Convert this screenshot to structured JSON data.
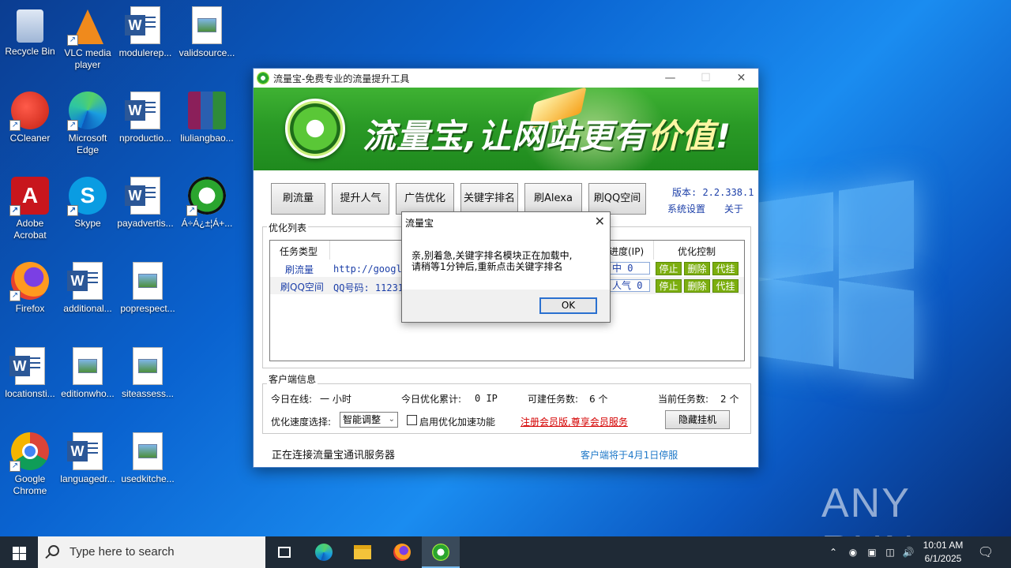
{
  "desktop": {
    "icons": [
      {
        "label": "Recycle Bin",
        "icon": "recycle-bin-icon"
      },
      {
        "label": "VLC media player",
        "icon": "vlc-icon"
      },
      {
        "label": "modulerep...",
        "icon": "word-doc-icon"
      },
      {
        "label": "validsource...",
        "icon": "image-file-icon"
      },
      {
        "label": "CCleaner",
        "icon": "ccleaner-icon"
      },
      {
        "label": "Microsoft Edge",
        "icon": "edge-icon"
      },
      {
        "label": "nproductio...",
        "icon": "word-doc-icon"
      },
      {
        "label": "liuliangbao...",
        "icon": "winrar-icon"
      },
      {
        "label": "Adobe Acrobat",
        "icon": "acrobat-icon"
      },
      {
        "label": "Skype",
        "icon": "skype-icon"
      },
      {
        "label": "payadvertis...",
        "icon": "word-doc-icon"
      },
      {
        "label": "Á÷Á¿±¦Á+...",
        "icon": "liuliangbao-icon"
      },
      {
        "label": "Firefox",
        "icon": "firefox-icon"
      },
      {
        "label": "additional...",
        "icon": "word-doc-icon"
      },
      {
        "label": "poprespect...",
        "icon": "image-file-icon"
      },
      {
        "label": "locationsti...",
        "icon": "word-doc-icon"
      },
      {
        "label": "editionwho...",
        "icon": "image-file-icon"
      },
      {
        "label": "siteassess...",
        "icon": "image-file-icon"
      },
      {
        "label": "Google Chrome",
        "icon": "chrome-icon"
      },
      {
        "label": "languagedr...",
        "icon": "word-doc-icon"
      },
      {
        "label": "usedkitche...",
        "icon": "image-file-icon"
      }
    ],
    "watermark": "ANY RUN"
  },
  "window": {
    "title": "流量宝-免费专业的流量提升工具",
    "banner": {
      "slogan_main": "流量宝,让网站更有",
      "slogan_highlight": "价值",
      "slogan_end": "!"
    },
    "nav_buttons": [
      "刷流量",
      "提升人气",
      "广告优化",
      "关键字排名",
      "刷Alexa",
      "刷QQ空间"
    ],
    "version": "版本: 2.2.338.1",
    "links": {
      "settings": "系统设置",
      "about": "关于"
    },
    "optlist": {
      "title": "优化列表",
      "headers": {
        "task_type": "任务类型",
        "progress": "进度(IP)",
        "control": "优化控制"
      },
      "rows": [
        {
          "type": "刷流量",
          "target": "http://google.c",
          "progress": "中 0"
        },
        {
          "type": "刷QQ空间",
          "target": "QQ号码: 11231",
          "progress": "人气 0"
        }
      ],
      "ctrl": {
        "stop": "停止",
        "delete": "删除",
        "hang": "代挂"
      }
    },
    "client": {
      "title": "客户端信息",
      "online_label": "今日在线:",
      "online_value": "一 小时",
      "accum_label": "今日优化累计:",
      "accum_value": "0 IP",
      "available_label": "可建任务数:",
      "available_value": "6 个",
      "current_label": "当前任务数:",
      "current_value": "2 个",
      "speed_label": "优化速度选择:",
      "speed_value": "智能调整",
      "accel_label": "启用优化加速功能",
      "register_link": "注册会员版,尊享会员服务",
      "hide_button": "隐藏挂机"
    },
    "status": {
      "left": "正在连接流量宝通讯服务器",
      "right": "客户端将于4月1日停服"
    }
  },
  "dialog": {
    "title": "流量宝",
    "message_line1": "亲,别着急,关键字排名模块正在加载中,",
    "message_line2": "请稍等1分钟后,重新点击关键字排名",
    "ok": "OK"
  },
  "taskbar": {
    "search_placeholder": "Type here to search",
    "time": "10:01 AM",
    "date": "6/1/2025"
  }
}
